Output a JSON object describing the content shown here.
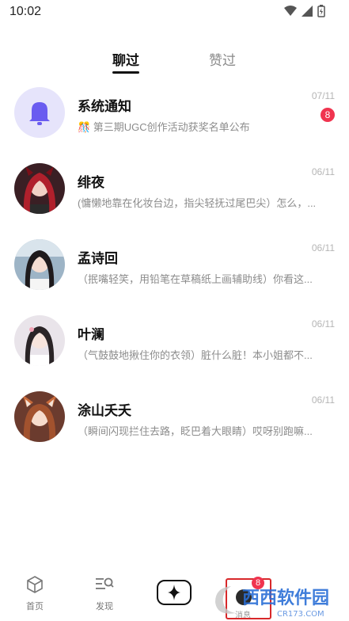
{
  "status_bar": {
    "time": "10:02"
  },
  "tabs": {
    "chat": "聊过",
    "liked": "赞过"
  },
  "conversations": [
    {
      "name": "系统通知",
      "date": "07/11",
      "preview": "🎊 第三期UGC创作活动获奖名单公布",
      "unread": "8"
    },
    {
      "name": "绯夜",
      "date": "06/11",
      "preview": "(慵懒地靠在化妆台边，指尖轻抚过尾巴尖）怎么，..."
    },
    {
      "name": "孟诗回",
      "date": "06/11",
      "preview": "（抿嘴轻笑，用铅笔在草稿纸上画辅助线）你看这..."
    },
    {
      "name": "叶澜",
      "date": "06/11",
      "preview": "（气鼓鼓地揪住你的衣领）脏什么脏！本小姐都不..."
    },
    {
      "name": "涂山夭夭",
      "date": "06/11",
      "preview": "（瞬间闪现拦住去路，眨巴着大眼睛）哎呀别跑嘛..."
    }
  ],
  "bottom_nav": {
    "home": "首页",
    "discover": "发现",
    "messages_badge": "8",
    "messages_label": "消息"
  },
  "watermark": {
    "text": "西西软件园",
    "sub": "CR173.COM"
  },
  "colors": {
    "accent_red": "#f0344f",
    "highlight_red": "#d8282a",
    "bell_bg": "#e6e4fb",
    "bell_icon": "#6a5cf0"
  }
}
